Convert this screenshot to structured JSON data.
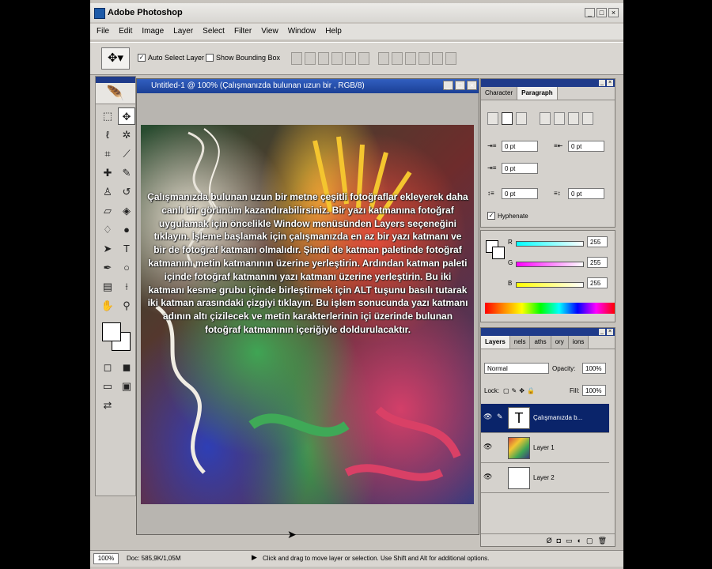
{
  "window": {
    "title": "Adobe Photoshop"
  },
  "menu": [
    "File",
    "Edit",
    "Image",
    "Layer",
    "Select",
    "Filter",
    "View",
    "Window",
    "Help"
  ],
  "options": {
    "auto_select": "Auto Select Layer",
    "bounding_box": "Show Bounding Box"
  },
  "document": {
    "title": "Untitled-1 @ 100% (Çalışmanızda bulunan uzun bir , RGB/8)",
    "canvas_text": "Çalışmanızda bulunan uzun bir metne çeşitli fotoğraflar ekleyerek daha canlı bir görünüm kazandırabilirsiniz. Bir yazı katmanına fotoğraf uygulamak için öncelikle Window menüsünden Layers seçeneğini tıklayın. İşleme başlamak için çalışmanızda en az bir yazı katmanı ve bir de fotoğraf katmanı olmalıdır. Şimdi de katman paletinde fotoğraf katmanını metin katmanının üzerine yerleştirin. Ardından katman paleti içinde fotoğraf katmanını yazı katmanı üzerine yerleştirin. Bu iki katmanı kesme grubu içinde birleştirmek için ALT tuşunu basılı tutarak iki katman arasındaki çizgiyi tıklayın. Bu işlem sonucunda yazı katmanı adının altı çizilecek ve metin karakterlerinin içi üzerinde bulunan fotoğraf katmanının içeriğiyle doldurulacaktır."
  },
  "status": {
    "zoom": "100%",
    "doc": "Doc: 585,9K/1,05M",
    "message": "Click and drag to move layer or selection.  Use Shift and Alt for additional options."
  },
  "paragraph_panel": {
    "tabs": [
      "Character",
      "Paragraph"
    ],
    "indent_left": "0 pt",
    "indent_right": "0 pt",
    "indent_first": "0 pt",
    "space_before": "0 pt",
    "space_after": "0 pt",
    "hyphenate": "Hyphenate"
  },
  "color_panel": {
    "channels": [
      {
        "label": "R",
        "value": "255"
      },
      {
        "label": "G",
        "value": "255"
      },
      {
        "label": "B",
        "value": "255"
      }
    ]
  },
  "layers_panel": {
    "tabs": [
      "Layers",
      "nels",
      "aths",
      "ory",
      "ions"
    ],
    "blend_mode": "Normal",
    "opacity_label": "Opacity:",
    "opacity": "100%",
    "lock_label": "Lock:",
    "fill_label": "Fill:",
    "fill": "100%",
    "layers": [
      {
        "name": "Çalışmanızda b...",
        "thumb": "T"
      },
      {
        "name": "Layer 1"
      },
      {
        "name": "Layer 2"
      }
    ]
  }
}
